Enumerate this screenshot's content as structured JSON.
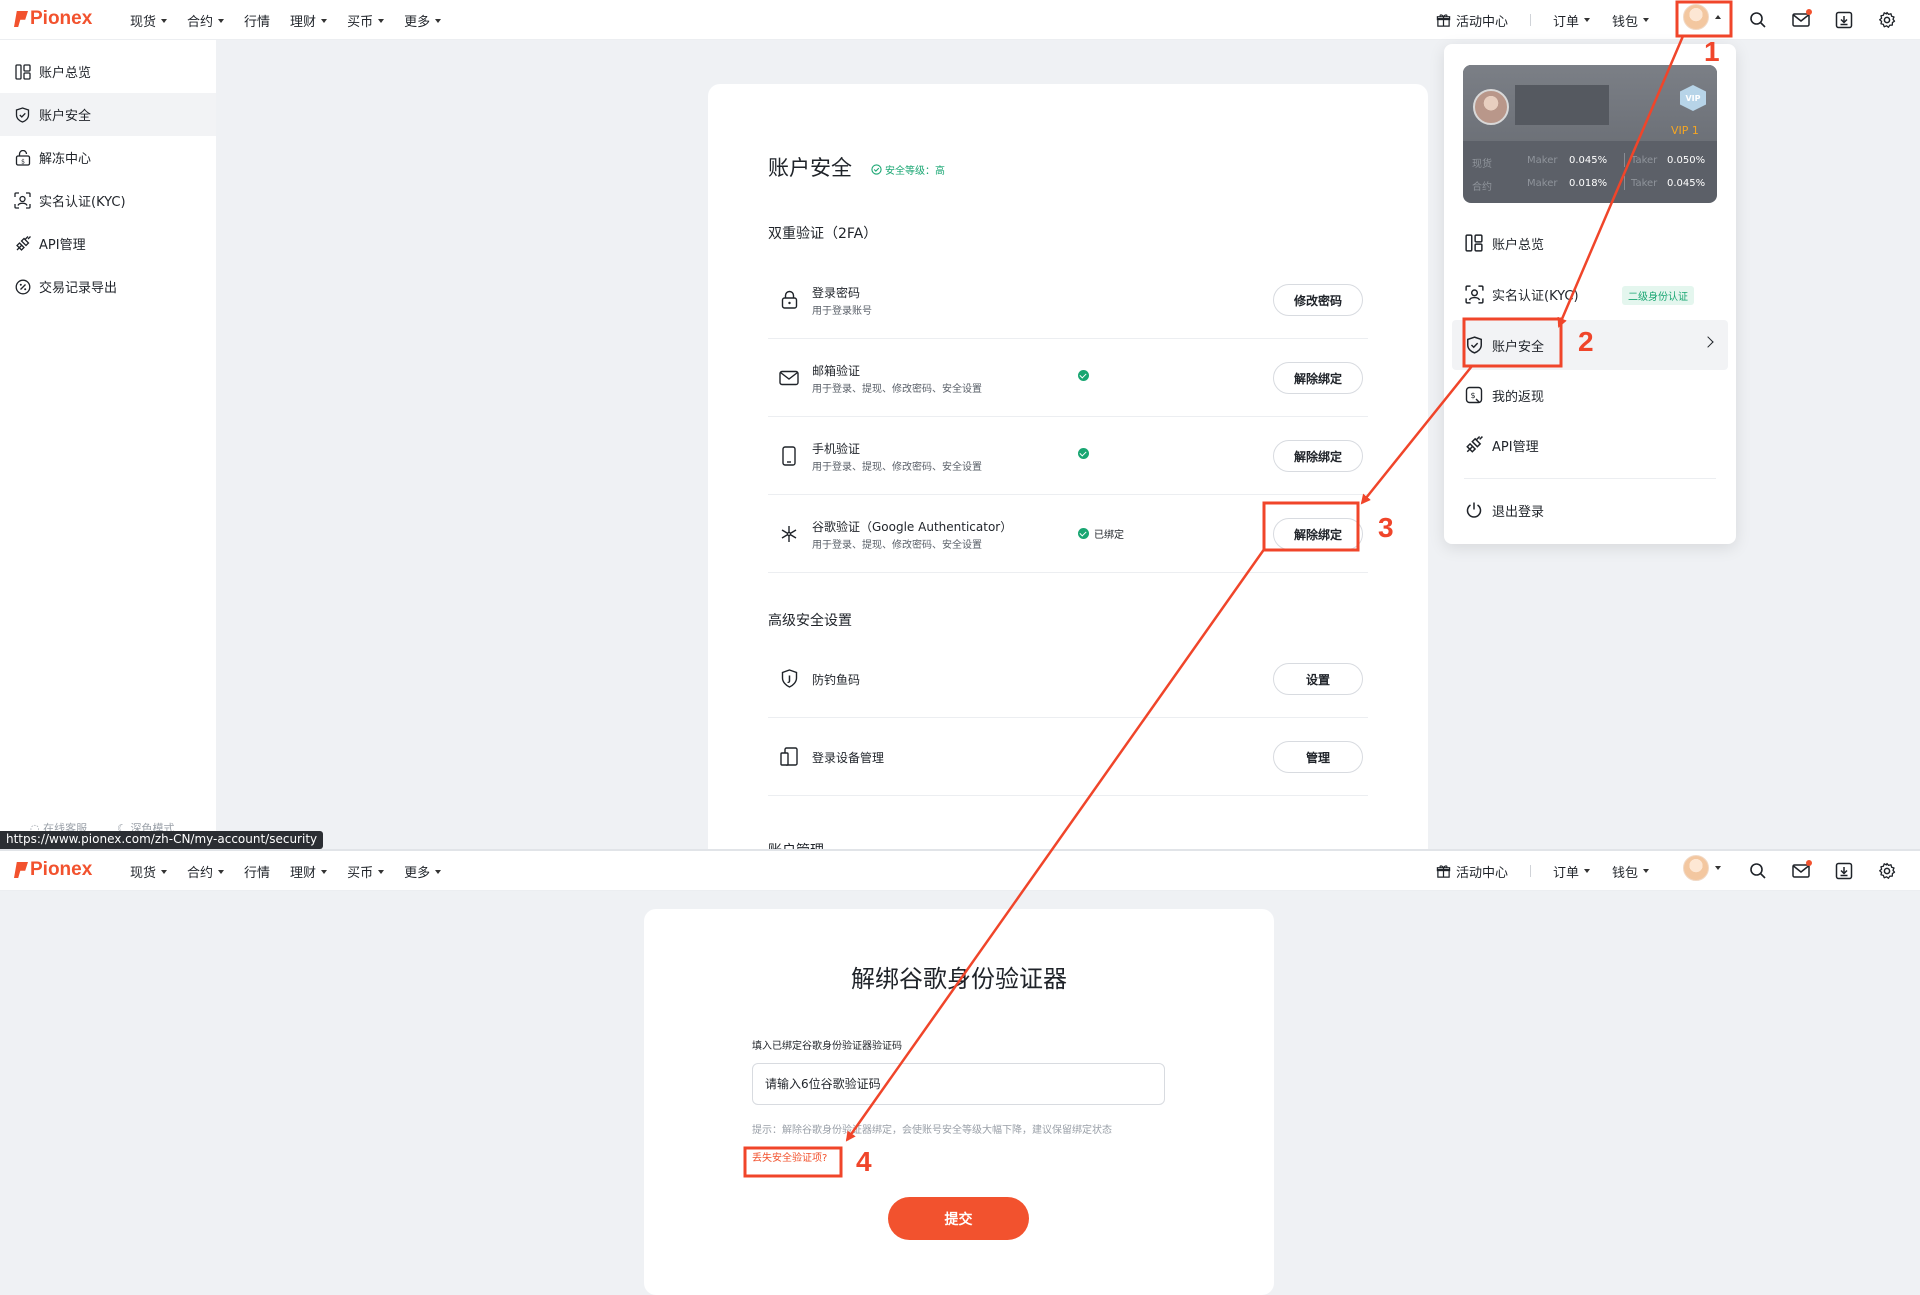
{
  "nav": {
    "logo": "Pionex",
    "menu": [
      {
        "label": "现货",
        "caret": true
      },
      {
        "label": "合约",
        "caret": true
      },
      {
        "label": "行情",
        "caret": false
      },
      {
        "label": "理财",
        "caret": true
      },
      {
        "label": "买币",
        "caret": true
      },
      {
        "label": "更多",
        "caret": true
      }
    ],
    "activity": "活动中心",
    "orders": "订单",
    "wallet": "钱包"
  },
  "sidebar": {
    "items": [
      {
        "label": "账户总览",
        "icon": "overview-icon"
      },
      {
        "label": "账户安全",
        "icon": "shield-icon"
      },
      {
        "label": "解冻中心",
        "icon": "unfreeze-icon"
      },
      {
        "label": "实名认证(KYC)",
        "icon": "kyc-icon"
      },
      {
        "label": "API管理",
        "icon": "api-icon"
      },
      {
        "label": "交易记录导出",
        "icon": "export-icon"
      }
    ],
    "footer_support": "在线客服",
    "footer_dark": "深色模式"
  },
  "status_url": "https://www.pionex.com/zh-CN/my-account/security",
  "security": {
    "title": "账户安全",
    "level": "安全等级：高",
    "twofa_heading": "双重验证（2FA）",
    "twofa_rows": [
      {
        "title": "登录密码",
        "sub": "用于登录账号",
        "status": "",
        "verified": false,
        "button": "修改密码"
      },
      {
        "title": "邮箱验证",
        "sub": "用于登录、提现、修改密码、安全设置",
        "status": "",
        "verified": true,
        "button": "解除绑定"
      },
      {
        "title": "手机验证",
        "sub": "用于登录、提现、修改密码、安全设置",
        "status": "",
        "verified": true,
        "button": "解除绑定"
      },
      {
        "title": "谷歌验证（Google Authenticator）",
        "sub": "用于登录、提现、修改密码、安全设置",
        "status": "已绑定",
        "verified": true,
        "button": "解除绑定"
      }
    ],
    "advanced_heading": "高级安全设置",
    "advanced_rows": [
      {
        "title": "防钓鱼码",
        "button": "设置"
      },
      {
        "title": "登录设备管理",
        "button": "管理"
      }
    ],
    "account_heading": "账户管理"
  },
  "dropdown": {
    "vip_level": "VIP 1",
    "vip_badge": "VIP",
    "fees": [
      {
        "market": "现货",
        "maker_label": "Maker",
        "maker": "0.045%",
        "taker_label": "Taker",
        "taker": "0.050%"
      },
      {
        "market": "合约",
        "maker_label": "Maker",
        "maker": "0.018%",
        "taker_label": "Taker",
        "taker": "0.045%"
      }
    ],
    "items": [
      {
        "label": "账户总览",
        "icon": "overview-icon"
      },
      {
        "label": "实名认证(KYC)",
        "icon": "kyc-icon",
        "tag": "二级身份认证"
      },
      {
        "label": "账户安全",
        "icon": "shield-icon"
      },
      {
        "label": "我的返现",
        "icon": "cashback-icon"
      },
      {
        "label": "API管理",
        "icon": "api-icon"
      }
    ],
    "logout": "退出登录"
  },
  "unbind_form": {
    "title": "解绑谷歌身份验证器",
    "label": "填入已绑定谷歌身份验证器验证码",
    "placeholder": "请输入6位谷歌验证码",
    "hint": "提示：解除谷歌身份验证器绑定，会使账号安全等级大幅下降，建议保留绑定状态",
    "lost_link": "丢失安全验证项?",
    "submit": "提交"
  },
  "annotations": {
    "color": "#f0452a",
    "steps": [
      "1",
      "2",
      "3",
      "4"
    ]
  },
  "colors": {
    "brand": "#f2522e",
    "success": "#19a672"
  }
}
